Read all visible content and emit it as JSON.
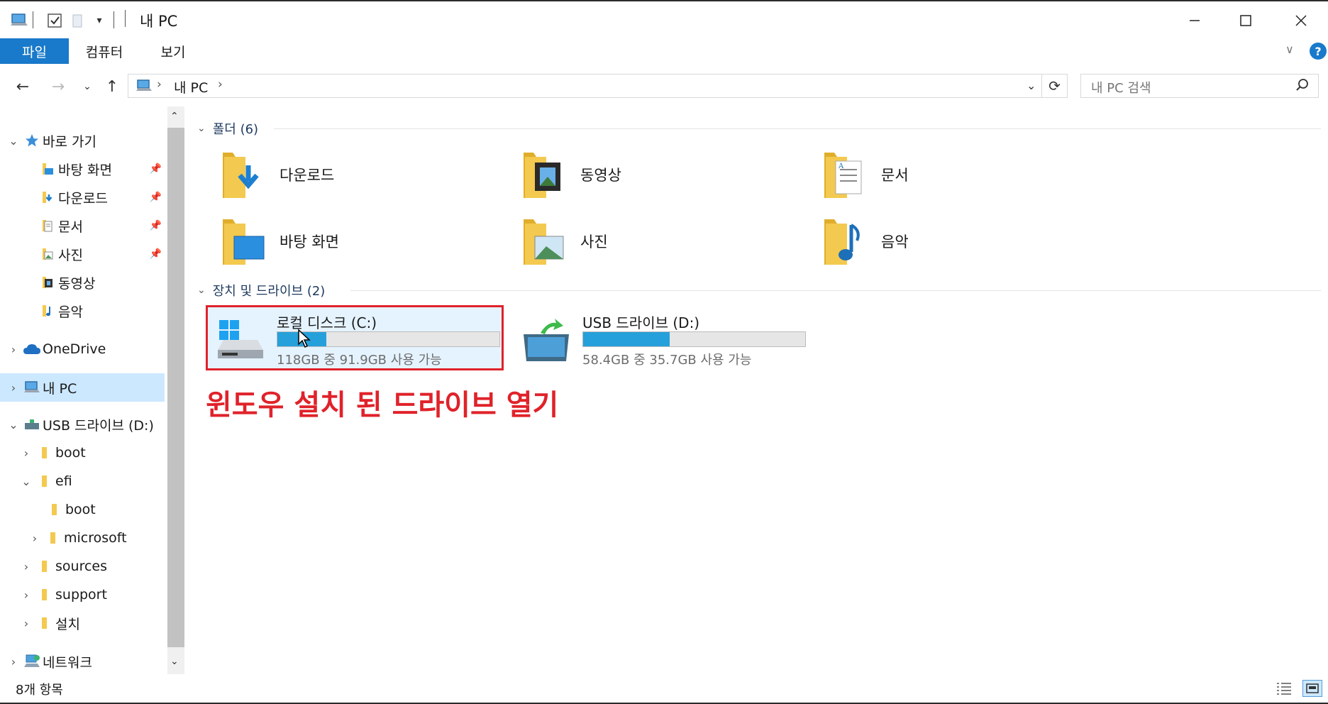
{
  "window": {
    "title": "내 PC"
  },
  "ribbon": {
    "tabs": [
      "파일",
      "컴퓨터",
      "보기"
    ]
  },
  "address": {
    "path": "내 PC",
    "search_placeholder": "내 PC 검색"
  },
  "nav_pane": {
    "quick_access": "바로 가기",
    "quick_items": [
      "바탕 화면",
      "다운로드",
      "문서",
      "사진",
      "동영상",
      "음악"
    ],
    "onedrive": "OneDrive",
    "this_pc": "내 PC",
    "usb": "USB 드라이브 (D:)",
    "usb_children": [
      "boot",
      "efi",
      "boot",
      "microsoft",
      "sources",
      "support",
      "설치"
    ],
    "network": "네트워크"
  },
  "content": {
    "folders_header": "폴더 (6)",
    "folders": [
      "다운로드",
      "동영상",
      "문서",
      "바탕 화면",
      "사진",
      "음악"
    ],
    "drives_header": "장치 및 드라이브 (2)",
    "drives": [
      {
        "name": "로컬 디스크 (C:)",
        "free_text": "118GB 중 91.9GB 사용 가능",
        "used_fraction": 0.221
      },
      {
        "name": "USB 드라이브 (D:)",
        "free_text": "58.4GB 중 35.7GB 사용 가능",
        "used_fraction": 0.389
      }
    ]
  },
  "annotation": {
    "text": "윈도우 설치 된 드라이브 열기",
    "color": "#e0222a"
  },
  "status": {
    "item_count": "8개 항목"
  },
  "colors": {
    "accent": "#1979ca",
    "selection": "#cce8ff",
    "drive_fill": "#26a0da",
    "folder_yellow": "#f3c94f"
  }
}
